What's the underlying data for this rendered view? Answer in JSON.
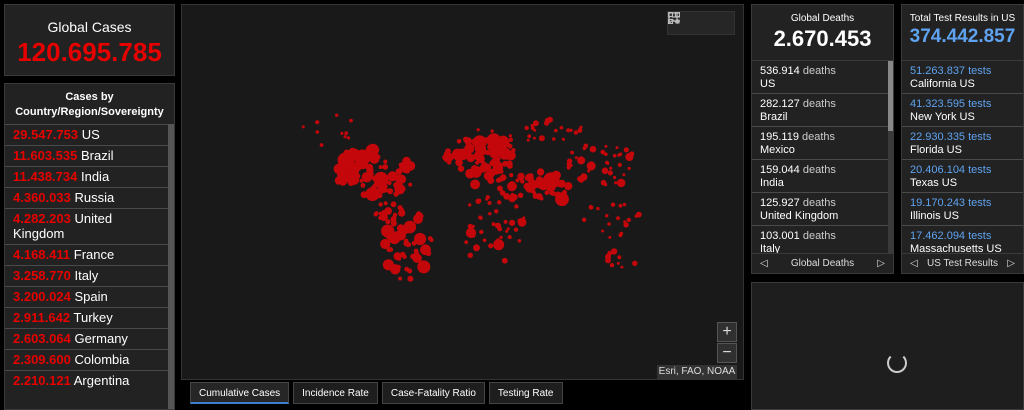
{
  "global_cases": {
    "label": "Global Cases",
    "value": "120.695.785"
  },
  "cases_by_country": {
    "title": "Cases by Country/Region/Sovereignty",
    "rows": [
      {
        "value": "29.547.753",
        "name": "US"
      },
      {
        "value": "11.603.535",
        "name": "Brazil"
      },
      {
        "value": "11.438.734",
        "name": "India"
      },
      {
        "value": "4.360.033",
        "name": "Russia"
      },
      {
        "value": "4.282.203",
        "name": "United Kingdom"
      },
      {
        "value": "4.168.411",
        "name": "France"
      },
      {
        "value": "3.258.770",
        "name": "Italy"
      },
      {
        "value": "3.200.024",
        "name": "Spain"
      },
      {
        "value": "2.911.642",
        "name": "Turkey"
      },
      {
        "value": "2.603.064",
        "name": "Germany"
      },
      {
        "value": "2.309.600",
        "name": "Colombia"
      },
      {
        "value": "2.210.121",
        "name": "Argentina"
      }
    ]
  },
  "map": {
    "attribution": "Esri, FAO, NOAA",
    "zoom_in": "+",
    "zoom_out": "−",
    "marker_color": "#c4070a",
    "tools": [
      "bookmark-icon",
      "list-icon",
      "qr-icon"
    ]
  },
  "map_tabs": [
    {
      "label": "Cumulative Cases",
      "active": true
    },
    {
      "label": "Incidence Rate",
      "active": false
    },
    {
      "label": "Case-Fatality Ratio",
      "active": false
    },
    {
      "label": "Testing Rate",
      "active": false
    }
  ],
  "global_deaths": {
    "label": "Global Deaths",
    "value": "2.670.453",
    "unit": "deaths",
    "rows": [
      {
        "value": "536.914",
        "name": "US"
      },
      {
        "value": "282.127",
        "name": "Brazil"
      },
      {
        "value": "195.119",
        "name": "Mexico"
      },
      {
        "value": "159.044",
        "name": "India"
      },
      {
        "value": "125.927",
        "name": "United Kingdom"
      },
      {
        "value": "103.001",
        "name": "Italy"
      }
    ],
    "pager_label": "Global Deaths"
  },
  "test_results": {
    "label": "Total Test Results in US",
    "value": "374.442.857",
    "unit": "tests",
    "rows": [
      {
        "value": "51.263.837",
        "name": "California US"
      },
      {
        "value": "41.323.595",
        "name": "New York US"
      },
      {
        "value": "22.930.335",
        "name": "Florida US"
      },
      {
        "value": "20.406.104",
        "name": "Texas US"
      },
      {
        "value": "19.170.243",
        "name": "Illinois US"
      },
      {
        "value": "17.462.094",
        "name": "Massachusetts US"
      }
    ],
    "pager_label": "US Test Results"
  },
  "colors": {
    "cases": "#e60000",
    "tests": "#5fa3f0",
    "background": "#000000",
    "panel": "#222222"
  }
}
